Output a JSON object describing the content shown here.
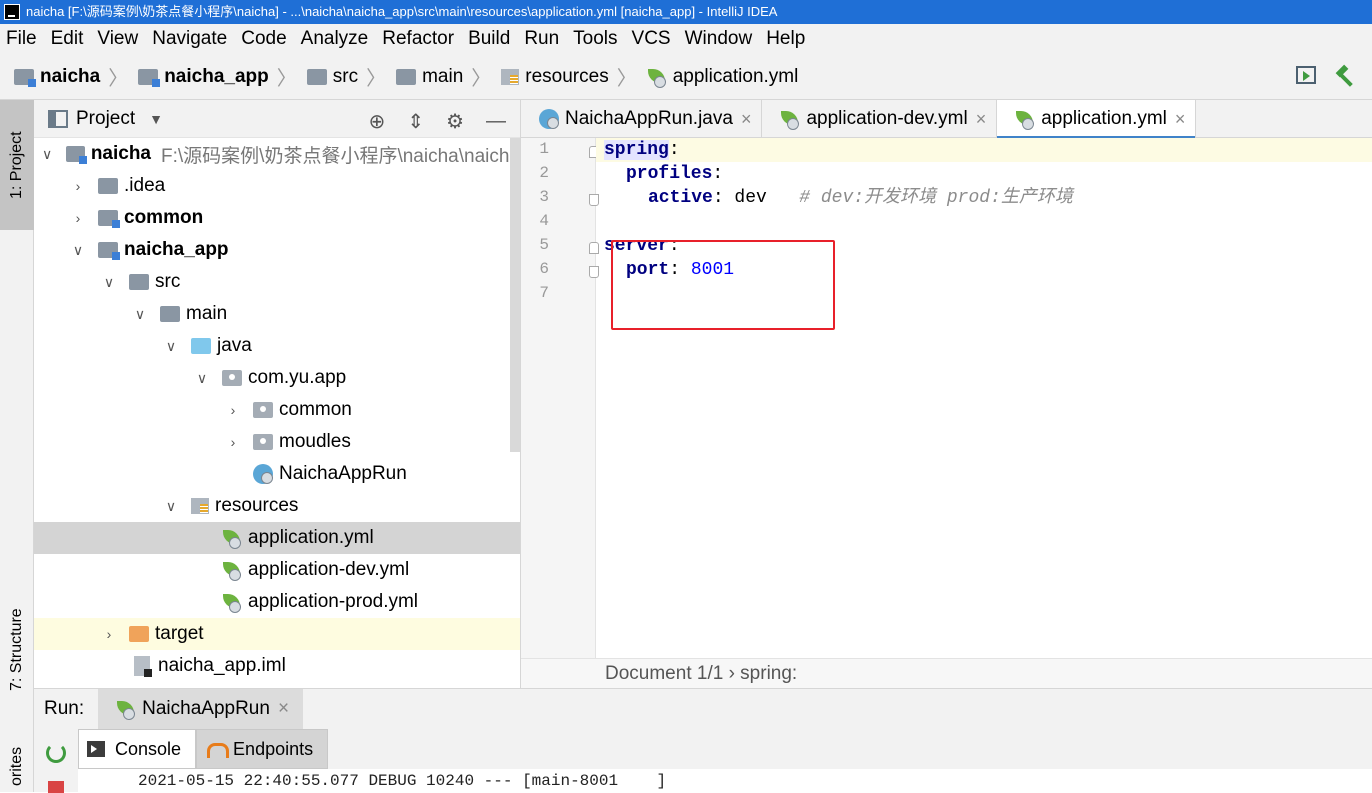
{
  "window": {
    "title": "naicha [F:\\源码案例\\奶茶点餐小程序\\naicha] - ...\\naicha\\naicha_app\\src\\main\\resources\\application.yml [naicha_app] - IntelliJ IDEA"
  },
  "menu": [
    "File",
    "Edit",
    "View",
    "Navigate",
    "Code",
    "Analyze",
    "Refactor",
    "Build",
    "Run",
    "Tools",
    "VCS",
    "Window",
    "Help"
  ],
  "breadcrumb": [
    "naicha",
    "naicha_app",
    "src",
    "main",
    "resources",
    "application.yml"
  ],
  "sidebar_tabs": {
    "project": "1: Project",
    "structure": "7: Structure",
    "favorites": "orites"
  },
  "project_panel": {
    "title": "Project",
    "tree": [
      {
        "label": "naicha",
        "path": "F:\\源码案例\\奶茶点餐小程序\\naicha\\naicha"
      },
      {
        "label": ".idea"
      },
      {
        "label": "common"
      },
      {
        "label": "naicha_app"
      },
      {
        "label": "src"
      },
      {
        "label": "main"
      },
      {
        "label": "java"
      },
      {
        "label": "com.yu.app"
      },
      {
        "label": "common"
      },
      {
        "label": "moudles"
      },
      {
        "label": "NaichaAppRun"
      },
      {
        "label": "resources"
      },
      {
        "label": "application.yml"
      },
      {
        "label": "application-dev.yml"
      },
      {
        "label": "application-prod.yml"
      },
      {
        "label": "target"
      },
      {
        "label": "naicha_app.iml"
      }
    ]
  },
  "editor": {
    "tabs": [
      "NaichaAppRun.java",
      "application-dev.yml",
      "application.yml"
    ],
    "line_numbers": [
      "1",
      "2",
      "3",
      "4",
      "5",
      "6",
      "7"
    ],
    "code": {
      "l1_key": "spring",
      "l1_colon": ":",
      "l2_key": "profiles",
      "l2_colon": ":",
      "l3_key": "active",
      "l3_colon": ":",
      "l3_val": " dev",
      "l3_comment": "# dev:开发环境 prod:生产环境",
      "l5_key": "server",
      "l5_colon": ":",
      "l6_key": "port",
      "l6_colon": ":",
      "l6_val": "8001"
    },
    "status": "Document 1/1 › spring:"
  },
  "run_panel": {
    "label": "Run:",
    "tab": "NaichaAppRun",
    "subtabs": [
      "Console",
      "Endpoints"
    ],
    "log_line": "2021-05-15 22:40:55.077 DEBUG 10240 --- [main-8001    ]"
  }
}
